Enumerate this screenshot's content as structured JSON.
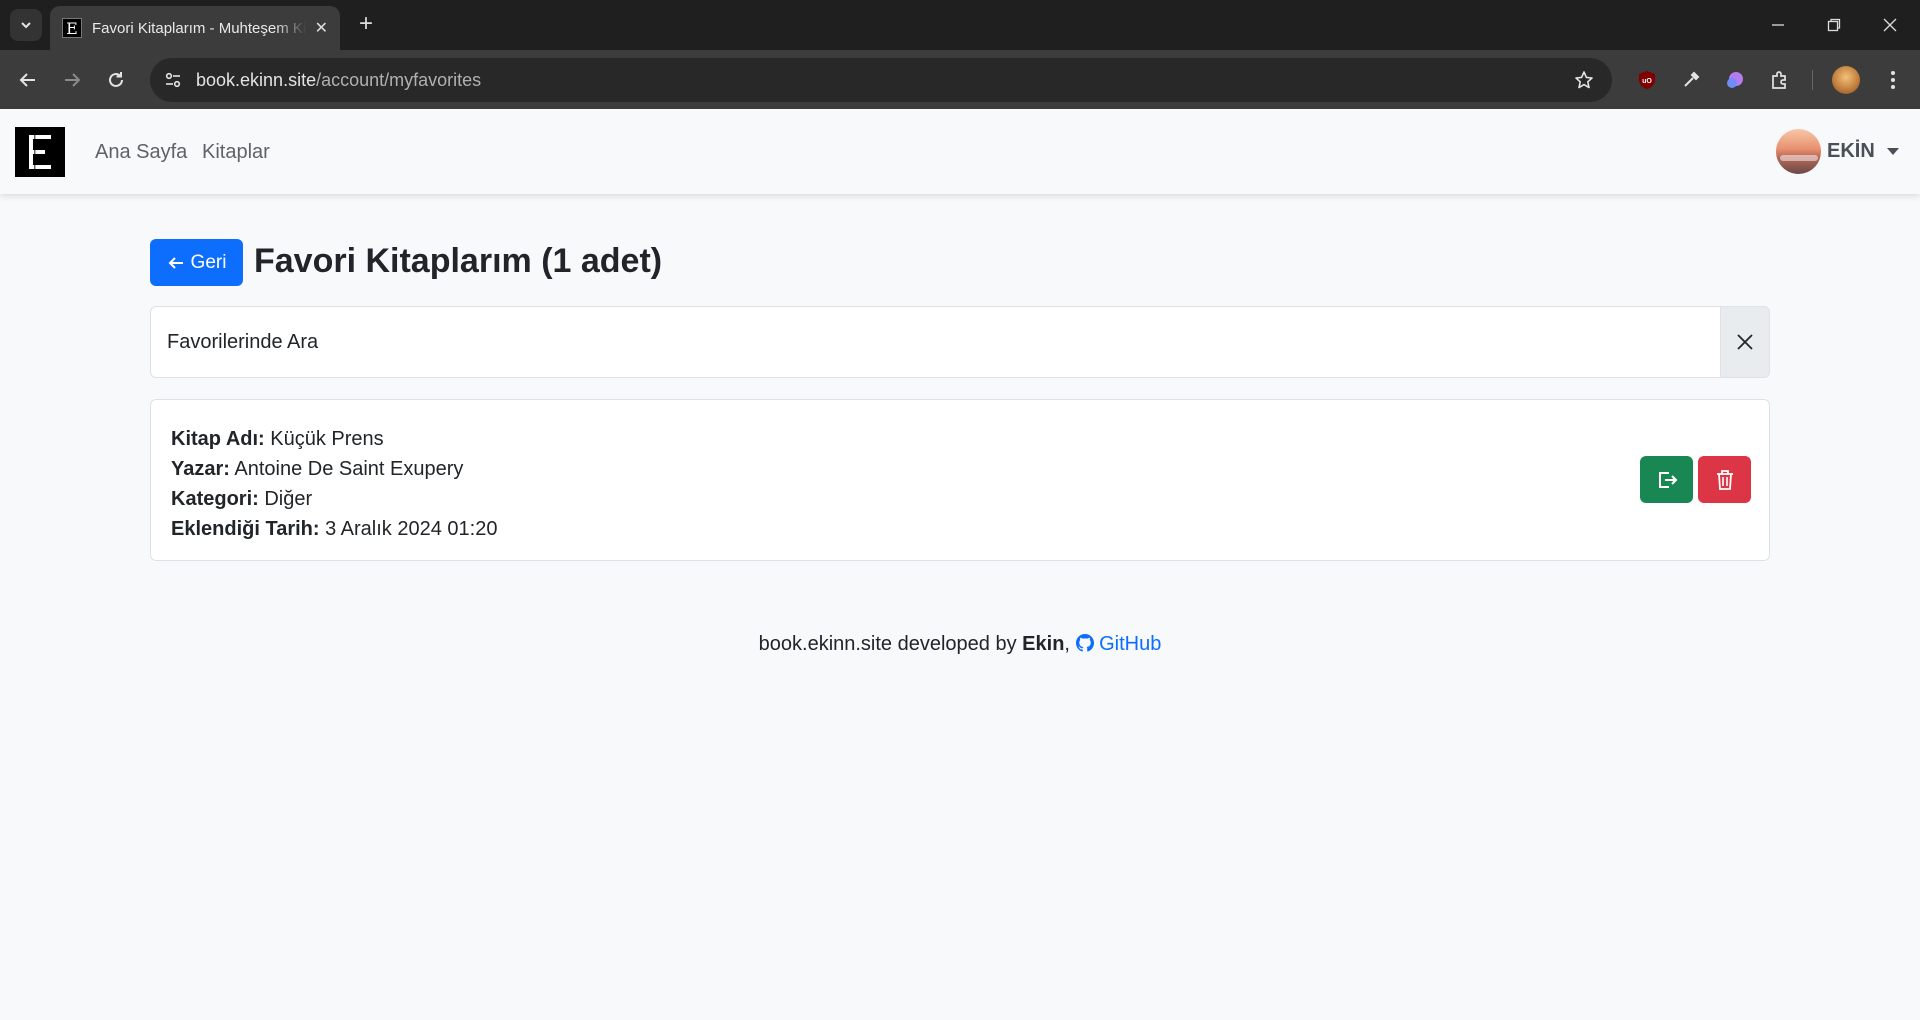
{
  "browser": {
    "tab_title": "Favori Kitaplarım - Muhteşem Kitaplar",
    "favicon_letter": "E",
    "url_host": "book.ekinn.site",
    "url_path": "/account/myfavorites"
  },
  "navbar": {
    "brand_letter": "E",
    "links": [
      "Ana Sayfa",
      "Kitaplar"
    ],
    "user_name": "EKİN"
  },
  "page": {
    "back_label": "Geri",
    "title": "Favori Kitaplarım (1 adet)",
    "search_placeholder": "Favorilerinde Ara"
  },
  "favorites": [
    {
      "name_label": "Kitap Adı:",
      "name": "Küçük Prens",
      "author_label": "Yazar:",
      "author": "Antoine De Saint Exupery",
      "category_label": "Kategori:",
      "category": "Diğer",
      "date_label": "Eklendiği Tarih:",
      "date": "3 Aralık 2024 01:20"
    }
  ],
  "footer": {
    "text": "book.ekinn.site developed by",
    "author": "Ekin",
    "link": "GitHub"
  },
  "colors": {
    "primary": "#0d6efd",
    "success": "#198754",
    "danger": "#dc3545"
  }
}
